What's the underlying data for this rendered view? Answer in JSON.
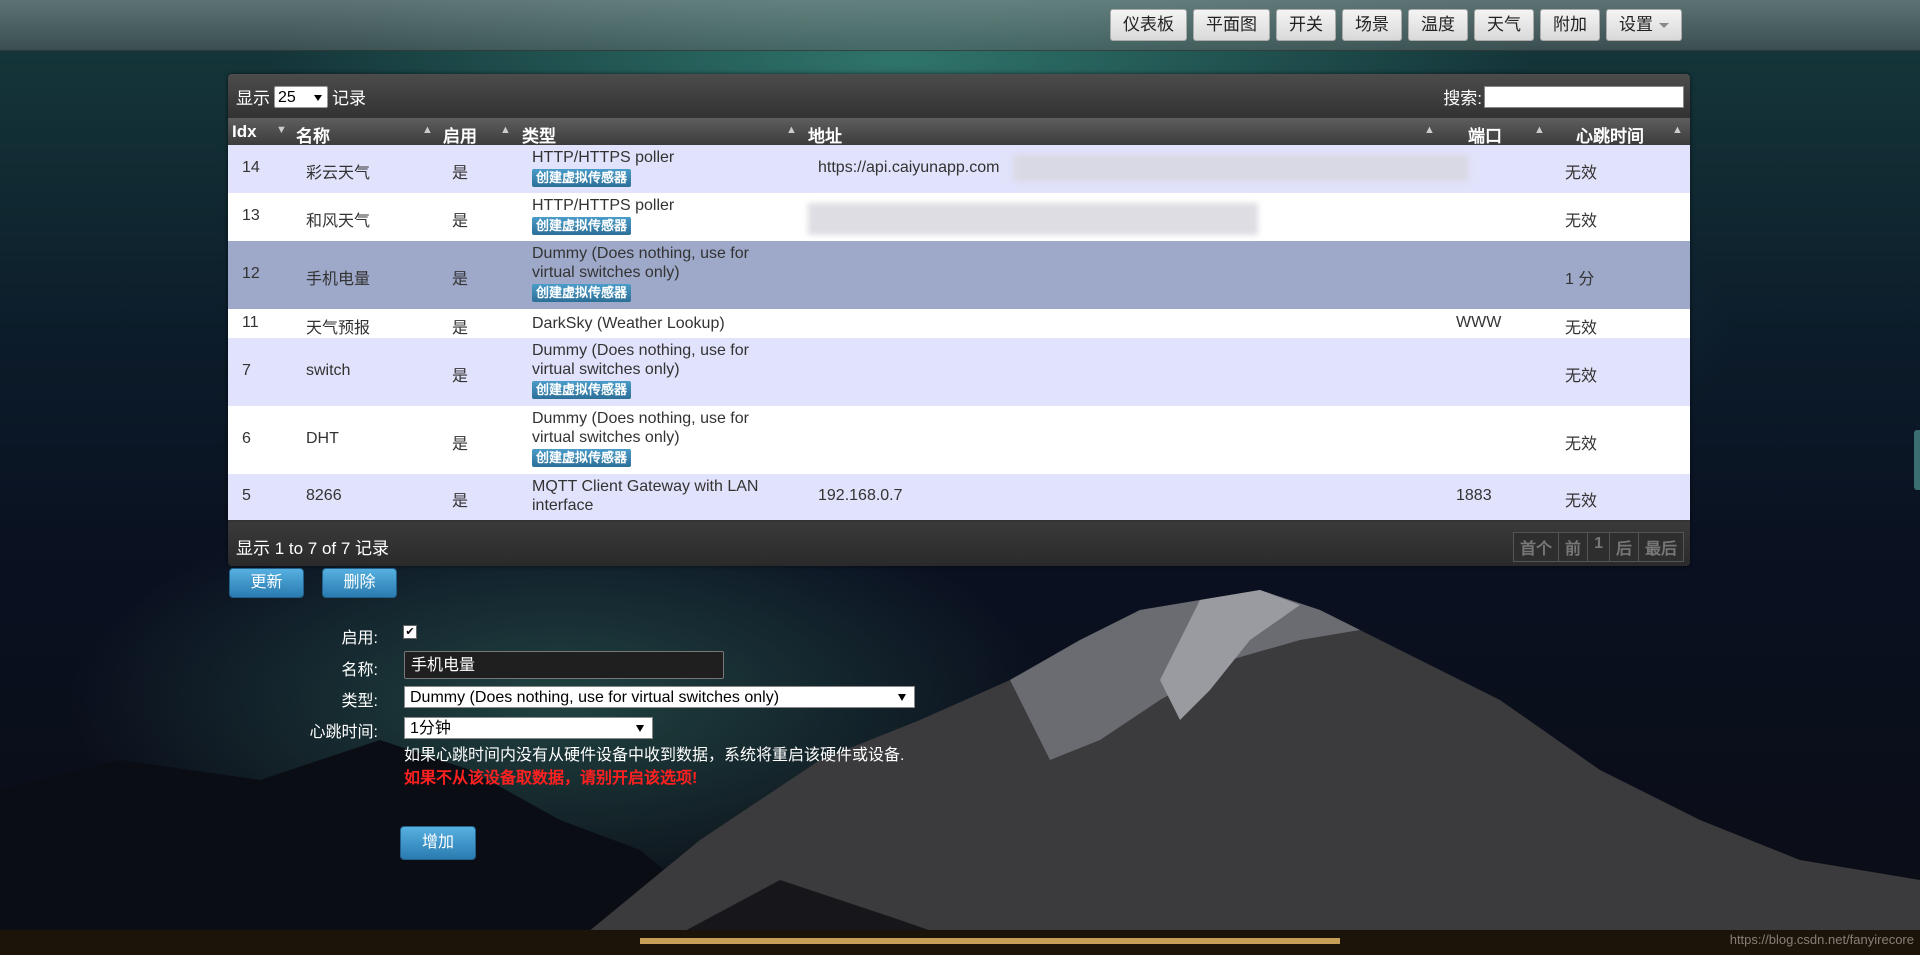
{
  "nav": [
    {
      "label": "仪表板"
    },
    {
      "label": "平面图"
    },
    {
      "label": "开关"
    },
    {
      "label": "场景"
    },
    {
      "label": "温度"
    },
    {
      "label": "天气"
    },
    {
      "label": "附加"
    },
    {
      "label": "设置",
      "dropdown": true
    }
  ],
  "toolbar": {
    "show_prefix": "显示",
    "page_size": "25",
    "show_suffix": "记录",
    "search_label": "搜索:",
    "search_value": ""
  },
  "table": {
    "columns": [
      "Idx",
      "名称",
      "启用",
      "类型",
      "地址",
      "端口",
      "心跳时间"
    ],
    "rows": [
      {
        "idx": "14",
        "name": "彩云天气",
        "enabled": "是",
        "type": "HTTP/HTTPS poller",
        "type2": "",
        "action": "创建虚拟传感器",
        "address": "https://api.caiyunapp.com",
        "port": "",
        "heartbeat": "无效"
      },
      {
        "idx": "13",
        "name": "和风天气",
        "enabled": "是",
        "type": "HTTP/HTTPS poller",
        "type2": "",
        "action": "创建虚拟传感器",
        "address": "",
        "port": "",
        "heartbeat": "无效"
      },
      {
        "idx": "12",
        "name": "手机电量",
        "enabled": "是",
        "type": "Dummy (Does nothing, use for",
        "type2": "virtual switches only)",
        "action": "创建虚拟传感器",
        "address": "",
        "port": "",
        "heartbeat": "1 分"
      },
      {
        "idx": "11",
        "name": "天气预报",
        "enabled": "是",
        "type": "DarkSky (Weather Lookup)",
        "type2": "",
        "action": "",
        "address": "",
        "port": "WWW",
        "heartbeat": "无效"
      },
      {
        "idx": "7",
        "name": "switch",
        "enabled": "是",
        "type": "Dummy (Does nothing, use for",
        "type2": "virtual switches only)",
        "action": "创建虚拟传感器",
        "address": "",
        "port": "",
        "heartbeat": "无效"
      },
      {
        "idx": "6",
        "name": "DHT",
        "enabled": "是",
        "type": "Dummy (Does nothing, use for",
        "type2": "virtual switches only)",
        "action": "创建虚拟传感器",
        "address": "",
        "port": "",
        "heartbeat": "无效"
      },
      {
        "idx": "5",
        "name": "8266",
        "enabled": "是",
        "type": "MQTT Client Gateway with LAN",
        "type2": "interface",
        "action": "",
        "address": "192.168.0.7",
        "port": "1883",
        "heartbeat": "无效"
      }
    ],
    "selected_idx": "12"
  },
  "footer": {
    "info": "显示 1 to 7 of 7 记录",
    "pager": [
      "首个",
      "前",
      "1",
      "后",
      "最后"
    ]
  },
  "actions": {
    "update": "更新",
    "delete": "删除"
  },
  "form": {
    "enabled_label": "启用:",
    "enabled_checked": true,
    "name_label": "名称:",
    "name_value": "手机电量",
    "type_label": "类型:",
    "type_value": "Dummy (Does nothing, use for virtual switches only)",
    "heartbeat_label": "心跳时间:",
    "heartbeat_value": "1分钟",
    "hint": "如果心跳时间内没有从硬件设备中收到数据，系统将重启该硬件或设备.",
    "warning": "如果不从该设备取数据，请别开启该选项!",
    "add_button": "增加"
  },
  "watermark": "https://blog.csdn.net/fanyirecore"
}
